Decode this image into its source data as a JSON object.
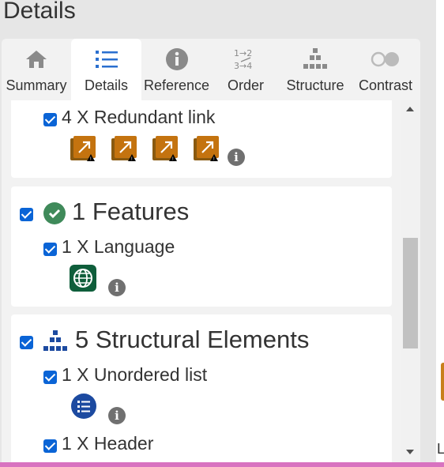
{
  "header": {
    "title": "Details"
  },
  "tabs": [
    {
      "label": "Summary",
      "icon": "home-icon"
    },
    {
      "label": "Details",
      "icon": "list-icon"
    },
    {
      "label": "Reference",
      "icon": "info-icon"
    },
    {
      "label": "Order",
      "icon": "order-icon"
    },
    {
      "label": "Structure",
      "icon": "hierarchy-icon"
    },
    {
      "label": "Contrast",
      "icon": "contrast-icon"
    }
  ],
  "active_tab": "Details",
  "content": {
    "redundant": {
      "label": "4 X Redundant link",
      "count": 4
    },
    "features": {
      "heading": "1 Features",
      "items": [
        {
          "label": "1 X Language"
        }
      ]
    },
    "structural": {
      "heading": "5 Structural Elements",
      "items": [
        {
          "label": "1 X Unordered list"
        },
        {
          "label": "1 X Header"
        }
      ]
    }
  },
  "info_glyph": "i",
  "right_edge_text": "L",
  "colors": {
    "checkbox": "#0a64d6",
    "alert_orange": "#c4730f",
    "feature_green": "#3f8a5a",
    "language_green": "#0f5e3b",
    "structure_blue": "#1c4aa0",
    "tab_icon_gray": "#8a8a8a"
  }
}
